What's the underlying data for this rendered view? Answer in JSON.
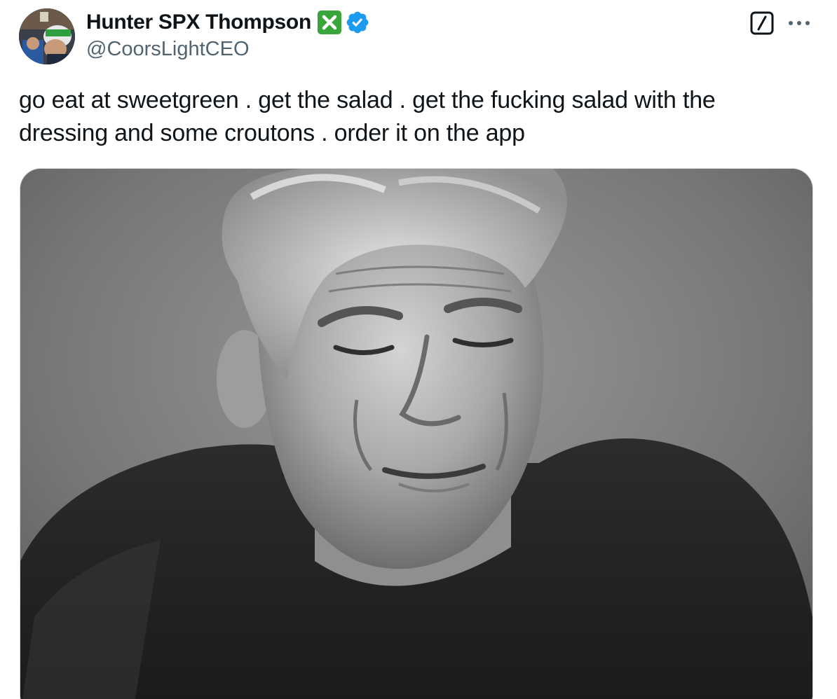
{
  "author": {
    "display_name": "Hunter SPX Thompson",
    "handle": "@CoorsLightCEO",
    "name_badge_icon": "cross-mark-icon",
    "verified_icon": "verified-badge-icon"
  },
  "header_actions": {
    "grok_icon": "grok-icon",
    "more_icon": "more-options-icon"
  },
  "tweet": {
    "text": "go eat at sweetgreen . get the salad . get the fucking salad with the\ndressing and some croutons . order it on the app"
  },
  "media": {
    "kind": "photo",
    "style": "black-and-white portrait"
  },
  "colors": {
    "text_primary": "#0f1419",
    "text_secondary": "#536471",
    "verified_blue": "#1d9bf0",
    "badge_green": "#3aa53a",
    "border": "#cfd9de"
  }
}
